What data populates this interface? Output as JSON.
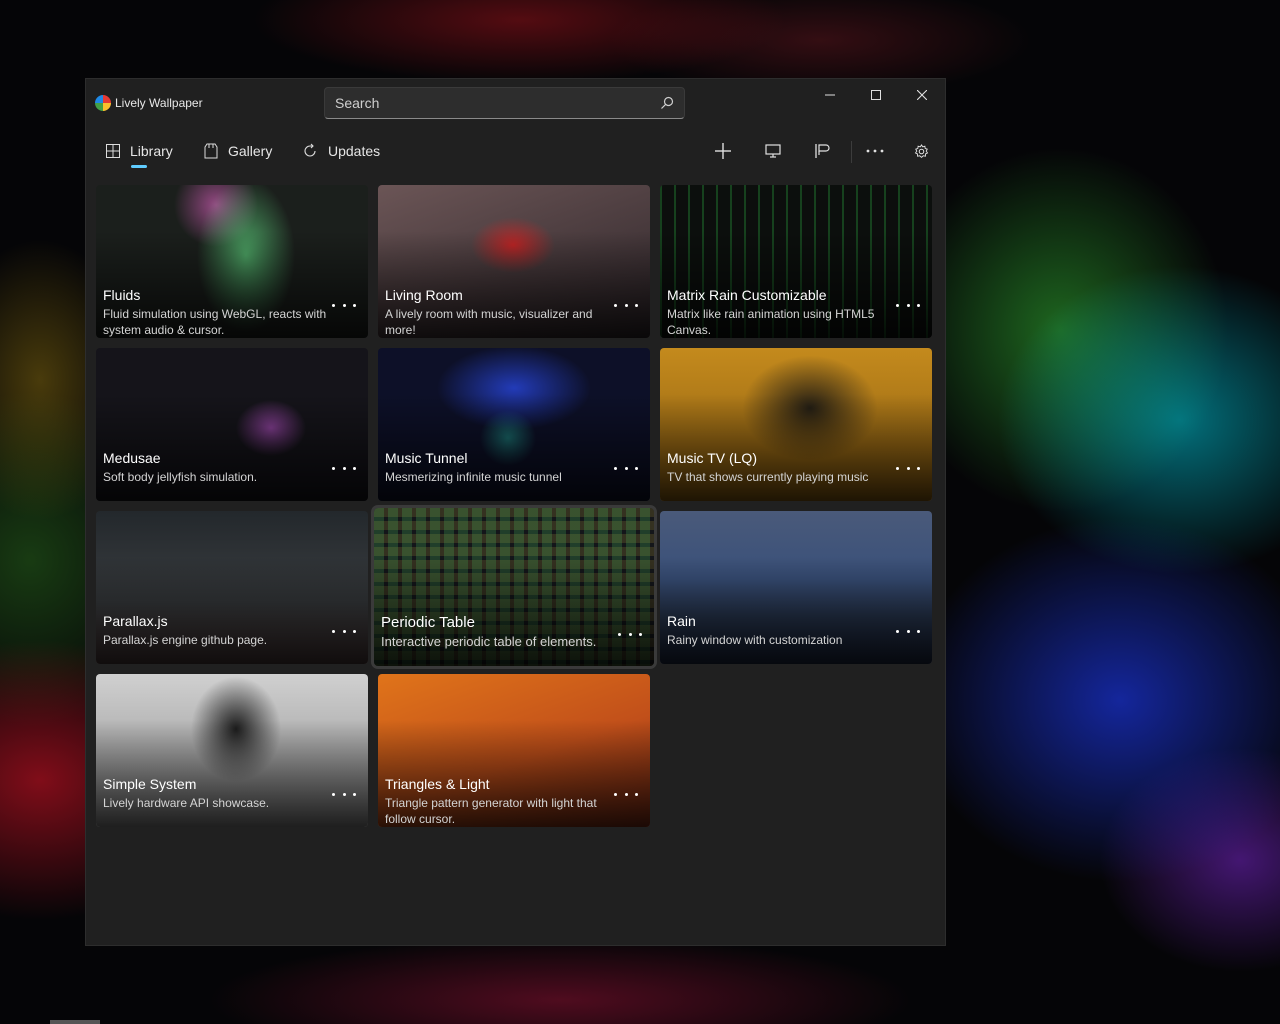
{
  "window": {
    "title": "Lively Wallpaper"
  },
  "search": {
    "placeholder": "Search"
  },
  "nav": [
    {
      "label": "Library"
    },
    {
      "label": "Gallery"
    },
    {
      "label": "Updates"
    }
  ],
  "nav_selected": "Library",
  "toolbar_icons": [
    "add-icon",
    "screen-icon",
    "customize-icon",
    "more-icon",
    "settings-icon"
  ],
  "wallpapers": [
    {
      "title": "Fluids",
      "description": "Fluid simulation using WebGL, reacts with system audio & cursor."
    },
    {
      "title": "Living Room",
      "description": "A lively room with music, visualizer and more!"
    },
    {
      "title": "Matrix Rain Customizable",
      "description": "Matrix like rain animation using HTML5 Canvas."
    },
    {
      "title": "Medusae",
      "description": "Soft body jellyfish simulation."
    },
    {
      "title": "Music Tunnel",
      "description": "Mesmerizing infinite music tunnel"
    },
    {
      "title": "Music TV (LQ)",
      "description": "TV that shows currently playing music"
    },
    {
      "title": "Parallax.js",
      "description": "Parallax.js engine github page."
    },
    {
      "title": "Periodic Table",
      "description": "Interactive periodic table of elements."
    },
    {
      "title": "Rain",
      "description": "Rainy window with customization"
    },
    {
      "title": "Simple System",
      "description": "Lively hardware API showcase."
    },
    {
      "title": "Triangles & Light",
      "description": "Triangle pattern generator with light that follow cursor."
    }
  ],
  "colors": {
    "accent": "#60cdff",
    "window_bg": "#202020"
  }
}
